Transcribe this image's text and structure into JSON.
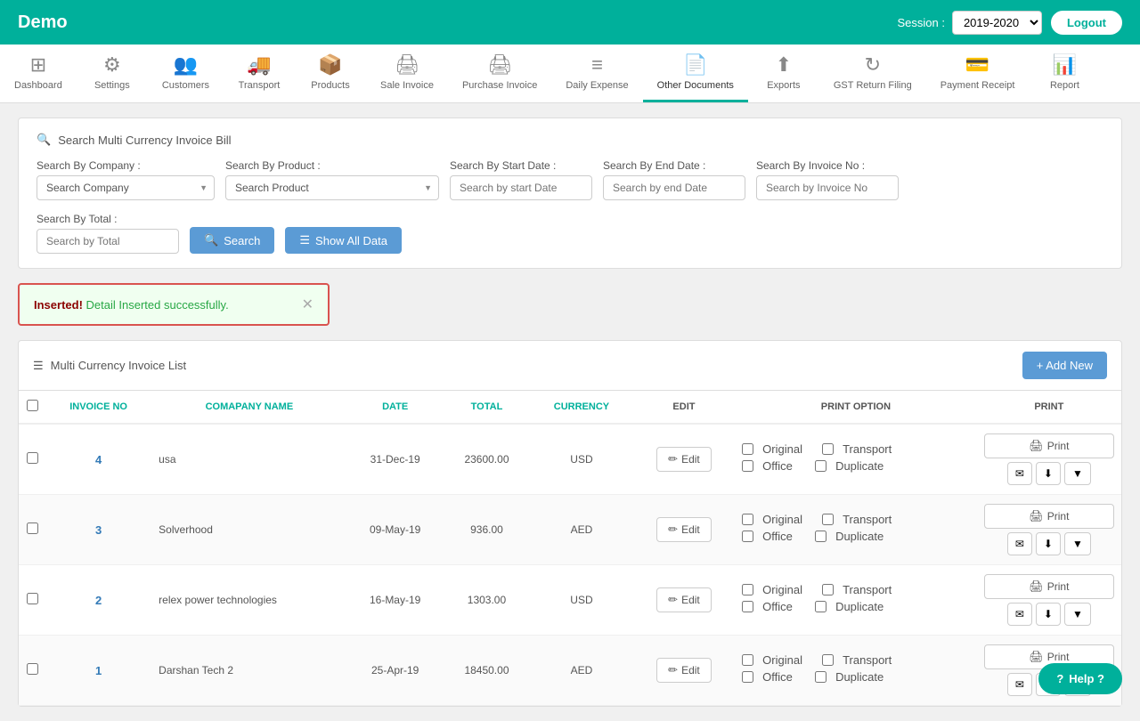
{
  "app": {
    "brand": "Demo",
    "session_label": "Session :",
    "session_value": "2019-2020",
    "logout_label": "Logout"
  },
  "nav": {
    "items": [
      {
        "id": "dashboard",
        "label": "Dashboard",
        "icon": "⊞"
      },
      {
        "id": "settings",
        "label": "Settings",
        "icon": "⚙"
      },
      {
        "id": "customers",
        "label": "Customers",
        "icon": "👥"
      },
      {
        "id": "transport",
        "label": "Transport",
        "icon": "🚚"
      },
      {
        "id": "products",
        "label": "Products",
        "icon": "📦"
      },
      {
        "id": "sale-invoice",
        "label": "Sale Invoice",
        "icon": "🖨"
      },
      {
        "id": "purchase-invoice",
        "label": "Purchase Invoice",
        "icon": "🖨"
      },
      {
        "id": "daily-expense",
        "label": "Daily Expense",
        "icon": "≡"
      },
      {
        "id": "other-documents",
        "label": "Other Documents",
        "icon": "📄",
        "active": true
      },
      {
        "id": "exports",
        "label": "Exports",
        "icon": "⬆"
      },
      {
        "id": "gst-return",
        "label": "GST Return Filing",
        "icon": "↻"
      },
      {
        "id": "payment-receipt",
        "label": "Payment Receipt",
        "icon": "💳"
      },
      {
        "id": "report",
        "label": "Report",
        "icon": "📊"
      }
    ]
  },
  "search": {
    "panel_title": "Search Multi Currency Invoice Bill",
    "company_label": "Search By Company :",
    "company_placeholder": "Search Company",
    "product_label": "Search By Product :",
    "product_placeholder": "Search Product",
    "start_date_label": "Search By Start Date :",
    "start_date_placeholder": "Search by start Date",
    "end_date_label": "Search By End Date :",
    "end_date_placeholder": "Search by end Date",
    "invoice_no_label": "Search By Invoice No :",
    "invoice_no_placeholder": "Search by Invoice No",
    "total_label": "Search By Total :",
    "total_placeholder": "Search by Total",
    "search_btn": "Search",
    "show_all_btn": "Show All Data"
  },
  "alert": {
    "inserted_label": "Inserted!",
    "detail_label": "Detail Inserted successfully."
  },
  "list": {
    "title": "Multi Currency Invoice List",
    "add_new_btn": "+ Add New",
    "columns": [
      "INVOICE NO",
      "COMAPANY NAME",
      "DATE",
      "TOTAL",
      "CURRENCY",
      "EDIT",
      "PRINT OPTION",
      "PRINT"
    ],
    "rows": [
      {
        "invoice_no": "4",
        "company": "usa",
        "date": "31-Dec-19",
        "total": "23600.00",
        "currency": "USD",
        "print_options": [
          "Original",
          "Transport",
          "Office",
          "Duplicate"
        ]
      },
      {
        "invoice_no": "3",
        "company": "Solverhood",
        "date": "09-May-19",
        "total": "936.00",
        "currency": "AED",
        "print_options": [
          "Original",
          "Transport",
          "Office",
          "Duplicate"
        ]
      },
      {
        "invoice_no": "2",
        "company": "relex power technologies",
        "date": "16-May-19",
        "total": "1303.00",
        "currency": "USD",
        "print_options": [
          "Original",
          "Transport",
          "Office",
          "Duplicate"
        ]
      },
      {
        "invoice_no": "1",
        "company": "Darshan Tech 2",
        "date": "25-Apr-19",
        "total": "18450.00",
        "currency": "AED",
        "print_options": [
          "Original",
          "Transport",
          "Office",
          "Duplicate"
        ]
      }
    ],
    "edit_label": "Edit",
    "print_label": "Print"
  },
  "help_btn": "Help ?"
}
